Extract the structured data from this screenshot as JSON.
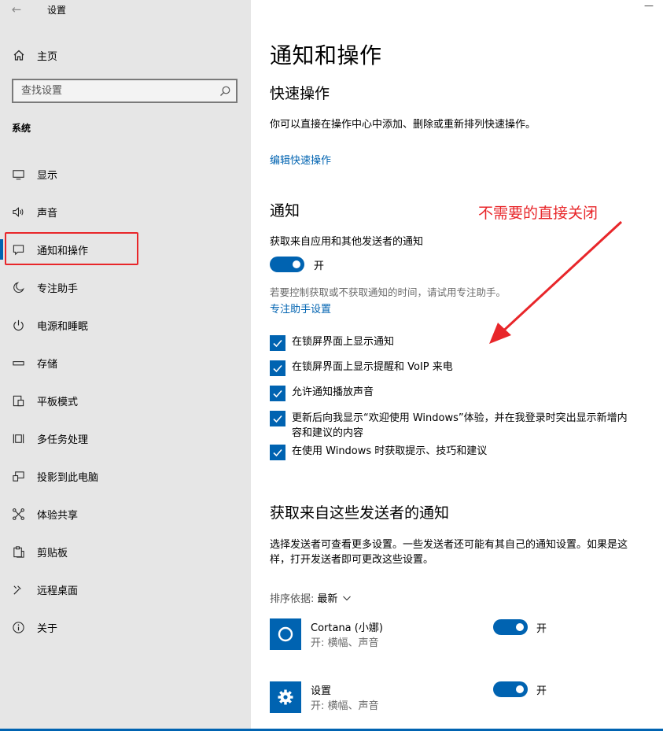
{
  "window": {
    "title": "设置",
    "minimize_glyph": "—"
  },
  "sidebar": {
    "home_label": "主页",
    "search_placeholder": "查找设置",
    "section_label": "系统",
    "items": [
      {
        "label": "显示",
        "icon": "display-icon"
      },
      {
        "label": "声音",
        "icon": "speaker-icon"
      },
      {
        "label": "通知和操作",
        "icon": "notification-icon",
        "active": true
      },
      {
        "label": "专注助手",
        "icon": "moon-icon"
      },
      {
        "label": "电源和睡眠",
        "icon": "power-icon"
      },
      {
        "label": "存储",
        "icon": "storage-icon"
      },
      {
        "label": "平板模式",
        "icon": "tablet-icon"
      },
      {
        "label": "多任务处理",
        "icon": "multitask-icon"
      },
      {
        "label": "投影到此电脑",
        "icon": "project-icon"
      },
      {
        "label": "体验共享",
        "icon": "share-icon"
      },
      {
        "label": "剪贴板",
        "icon": "clipboard-icon"
      },
      {
        "label": "远程桌面",
        "icon": "remote-desktop-icon"
      },
      {
        "label": "关于",
        "icon": "info-icon"
      }
    ]
  },
  "main": {
    "title": "通知和操作",
    "quick_actions": {
      "heading": "快速操作",
      "description": "你可以直接在操作中心中添加、删除或重新排列快速操作。",
      "edit_link": "编辑快速操作"
    },
    "notifications": {
      "heading": "通知",
      "get_label": "获取来自应用和其他发送者的通知",
      "toggle_state": "开",
      "focus_hint": "若要控制获取或不获取通知的时间，请试用专注助手。",
      "focus_link": "专注助手设置",
      "checkboxes": [
        {
          "label": "在锁屏界面上显示通知",
          "checked": true
        },
        {
          "label": "在锁屏界面上显示提醒和 VoIP 来电",
          "checked": true
        },
        {
          "label": "允许通知播放声音",
          "checked": true
        },
        {
          "label": "更新后向我显示“欢迎使用 Windows”体验，并在我登录时突出显示新增内容和建议的内容",
          "checked": true
        },
        {
          "label": "在使用 Windows 时获取提示、技巧和建议",
          "checked": true
        }
      ]
    },
    "senders": {
      "heading": "获取来自这些发送者的通知",
      "description": "选择发送者可查看更多设置。一些发送者还可能有其自己的通知设置。如果是这样，打开发送者即可更改这些设置。",
      "sort_key": "排序依据:",
      "sort_value": "最新",
      "apps": [
        {
          "name": "Cortana (小娜)",
          "detail": "开: 横幅、声音",
          "toggle_state": "开",
          "icon": "cortana-icon"
        },
        {
          "name": "设置",
          "detail": "开: 横幅、声音",
          "toggle_state": "开",
          "icon": "settings-gear-icon"
        }
      ]
    }
  },
  "annotation": {
    "text": "不需要的直接关闭",
    "color": "#e8262a"
  },
  "colors": {
    "accent": "#0063b1",
    "sidebar_bg": "#e6e6e6",
    "annotation_red": "#e8262a"
  }
}
